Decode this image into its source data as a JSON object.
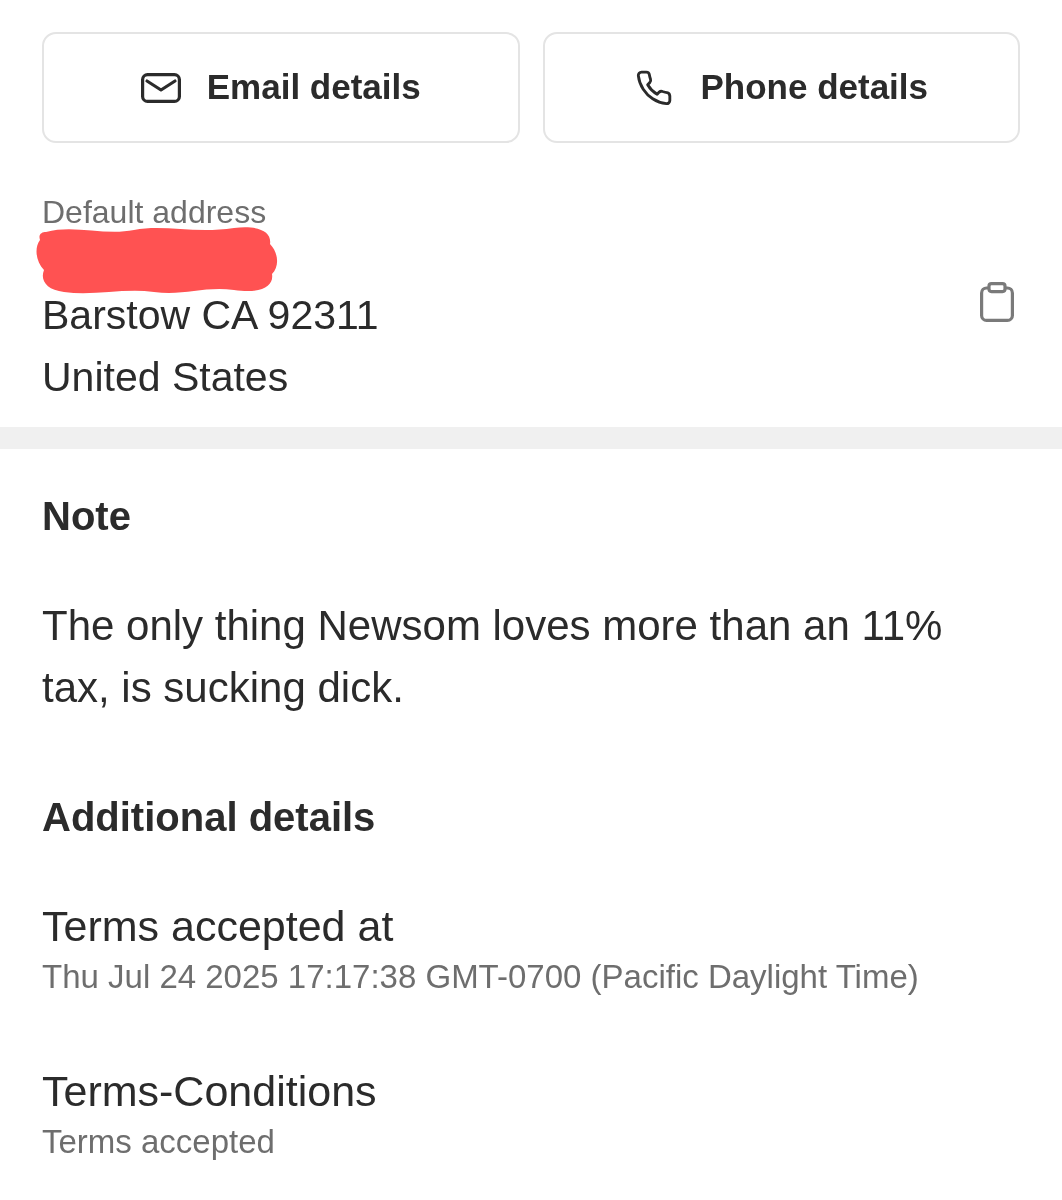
{
  "contact_buttons": [
    {
      "kind": "email",
      "label": "Email details"
    },
    {
      "kind": "phone",
      "label": "Phone details"
    }
  ],
  "default_address": {
    "label": "Default address",
    "redacted": true,
    "lines": [
      "Barstow CA 92311",
      "United States"
    ]
  },
  "note": {
    "heading": "Note",
    "text": "The only thing Newsom loves more than an 11% tax, is sucking dick."
  },
  "additional_details": {
    "heading": "Additional details",
    "fields": [
      {
        "label": "Terms accepted at",
        "value": "Thu Jul 24 2025 17:17:38 GMT-0700 (Pacific Daylight Time)"
      },
      {
        "label": "Terms-Conditions",
        "value": "Terms accepted"
      }
    ]
  }
}
